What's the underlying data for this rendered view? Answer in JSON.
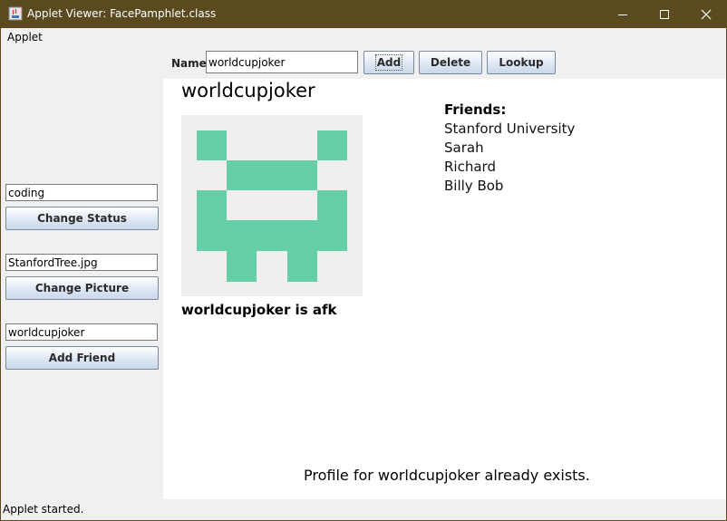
{
  "window": {
    "title": "Applet Viewer: FacePamphlet.class",
    "icon": "java-applet-icon",
    "controls": [
      "minimize-icon",
      "maximize-icon",
      "close-icon"
    ]
  },
  "menubar": {
    "applet_label": "Applet"
  },
  "toolbar": {
    "name_label": "Name",
    "name_value": "worldcupjoker",
    "add_label": "Add",
    "delete_label": "Delete",
    "lookup_label": "Lookup"
  },
  "sidebar": {
    "status_value": "coding",
    "change_status_label": "Change Status",
    "picture_value": "StanfordTree.jpg",
    "change_picture_label": "Change Picture",
    "friend_value": "worldcupjoker",
    "add_friend_label": "Add Friend"
  },
  "profile": {
    "name": "worldcupjoker",
    "status": "worldcupjoker is afk",
    "picture_color": "#67cfa7",
    "picture_background": "#efefef",
    "friends_header": "Friends:",
    "friends": [
      "Stanford University",
      "Sarah",
      "Richard",
      "Billy Bob"
    ]
  },
  "message": "Profile for worldcupjoker already exists.",
  "statusbar": {
    "text": "Applet started."
  }
}
